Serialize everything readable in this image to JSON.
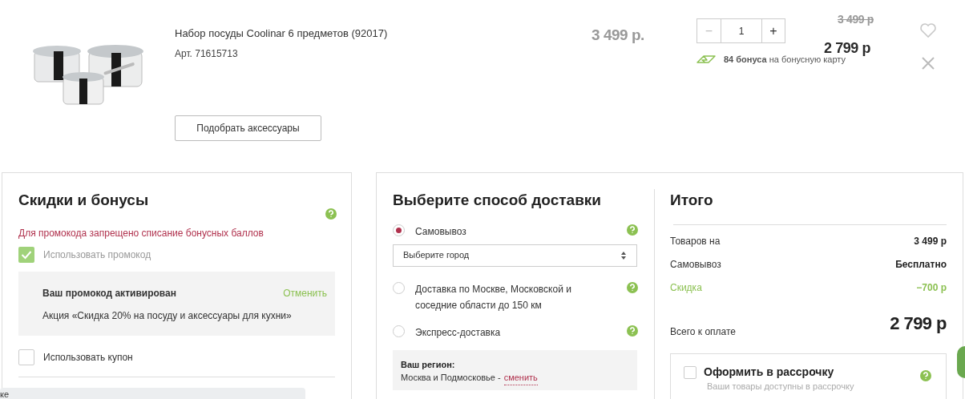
{
  "product": {
    "title": "Набор посуды Coolinar 6 предметов (92017)",
    "article": "Арт. 71615713",
    "price": "3 499 р.",
    "quantity": {
      "minus": "−",
      "value": "1",
      "plus": "+"
    },
    "old_price": "3 499 р",
    "new_price": "2 799 р",
    "bonus": "**84 бонуса** на бонусную карту",
    "accessories_button": "Подобрать аксессуары"
  },
  "discounts": {
    "title": "Скидки и бонусы",
    "warning": "Для промокода запрещено списание бонусных баллов",
    "promo_checkbox": {
      "label": "Использовать промокод",
      "checked": true
    },
    "promo_box": {
      "title": "Ваш промокод активирован",
      "cancel": "Отменить",
      "description": "Акция «Скидка 20% на посуду и аксессуары для кухни»"
    },
    "coupon_checkbox": {
      "label": "Использовать купон",
      "checked": false
    }
  },
  "delivery": {
    "title": "Выберите способ доставки",
    "options": [
      {
        "label": "Самовывоз",
        "selected": true,
        "city_select": "Выберите город"
      },
      {
        "label": "Доставка по Москве, Московской и соседние области до 150 км",
        "selected": false
      },
      {
        "label": "Экспресс-доставка",
        "selected": false
      }
    ],
    "region": {
      "label": "Ваш регион:",
      "value": "Москва и Подмосковье -",
      "link": "сменить"
    }
  },
  "summary": {
    "title": "Итого",
    "rows": [
      {
        "label": "Товаров на",
        "value": "3 499 р",
        "kind": "normal"
      },
      {
        "label": "Самовывоз",
        "value": "Бесплатно",
        "kind": "normal"
      },
      {
        "label": "Скидка",
        "value": "−700 р",
        "kind": "discount"
      }
    ],
    "total": {
      "label": "Всего к оплате",
      "value": "2 799 р"
    },
    "installment": {
      "label": "Оформить в рассрочку",
      "checked": false,
      "note": "Ваши товары доступны в рассрочку"
    }
  },
  "toast": {
    "text": "ке"
  }
}
